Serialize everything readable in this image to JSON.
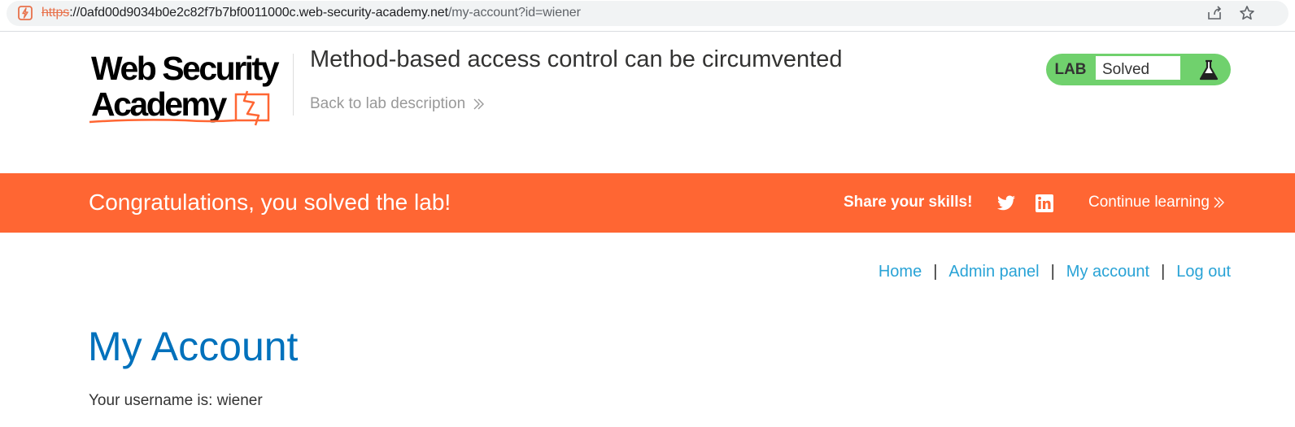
{
  "browser": {
    "url_scheme": "https",
    "url_host": "://0afd00d9034b0e2c82f7b7bf0011000c.web-security-academy.net",
    "url_path": "/my-account?id=wiener"
  },
  "header": {
    "logo_line1": "Web Security",
    "logo_line2": "Academy",
    "lab_title": "Method-based access control can be circumvented",
    "back_link": "Back to lab description",
    "status_lab": "LAB",
    "status_text": "Solved"
  },
  "banner": {
    "congrats": "Congratulations, you solved the lab!",
    "share_label": "Share your skills!",
    "continue_label": "Continue learning"
  },
  "nav": {
    "items": [
      {
        "label": "Home"
      },
      {
        "label": "Admin panel"
      },
      {
        "label": "My account"
      },
      {
        "label": "Log out"
      }
    ],
    "separator": "|"
  },
  "main": {
    "page_title": "My Account",
    "username_prefix": "Your username is: ",
    "username": "wiener"
  },
  "colors": {
    "accent_orange": "#ff6633",
    "solved_green": "#70d16d",
    "link_blue": "#29a3d6",
    "title_blue": "#0071bc"
  },
  "icons": [
    "site-security-icon",
    "share-icon",
    "star-icon",
    "academy-logo-icon",
    "chevron-double-right-icon",
    "flask-icon",
    "twitter-icon",
    "linkedin-icon"
  ]
}
